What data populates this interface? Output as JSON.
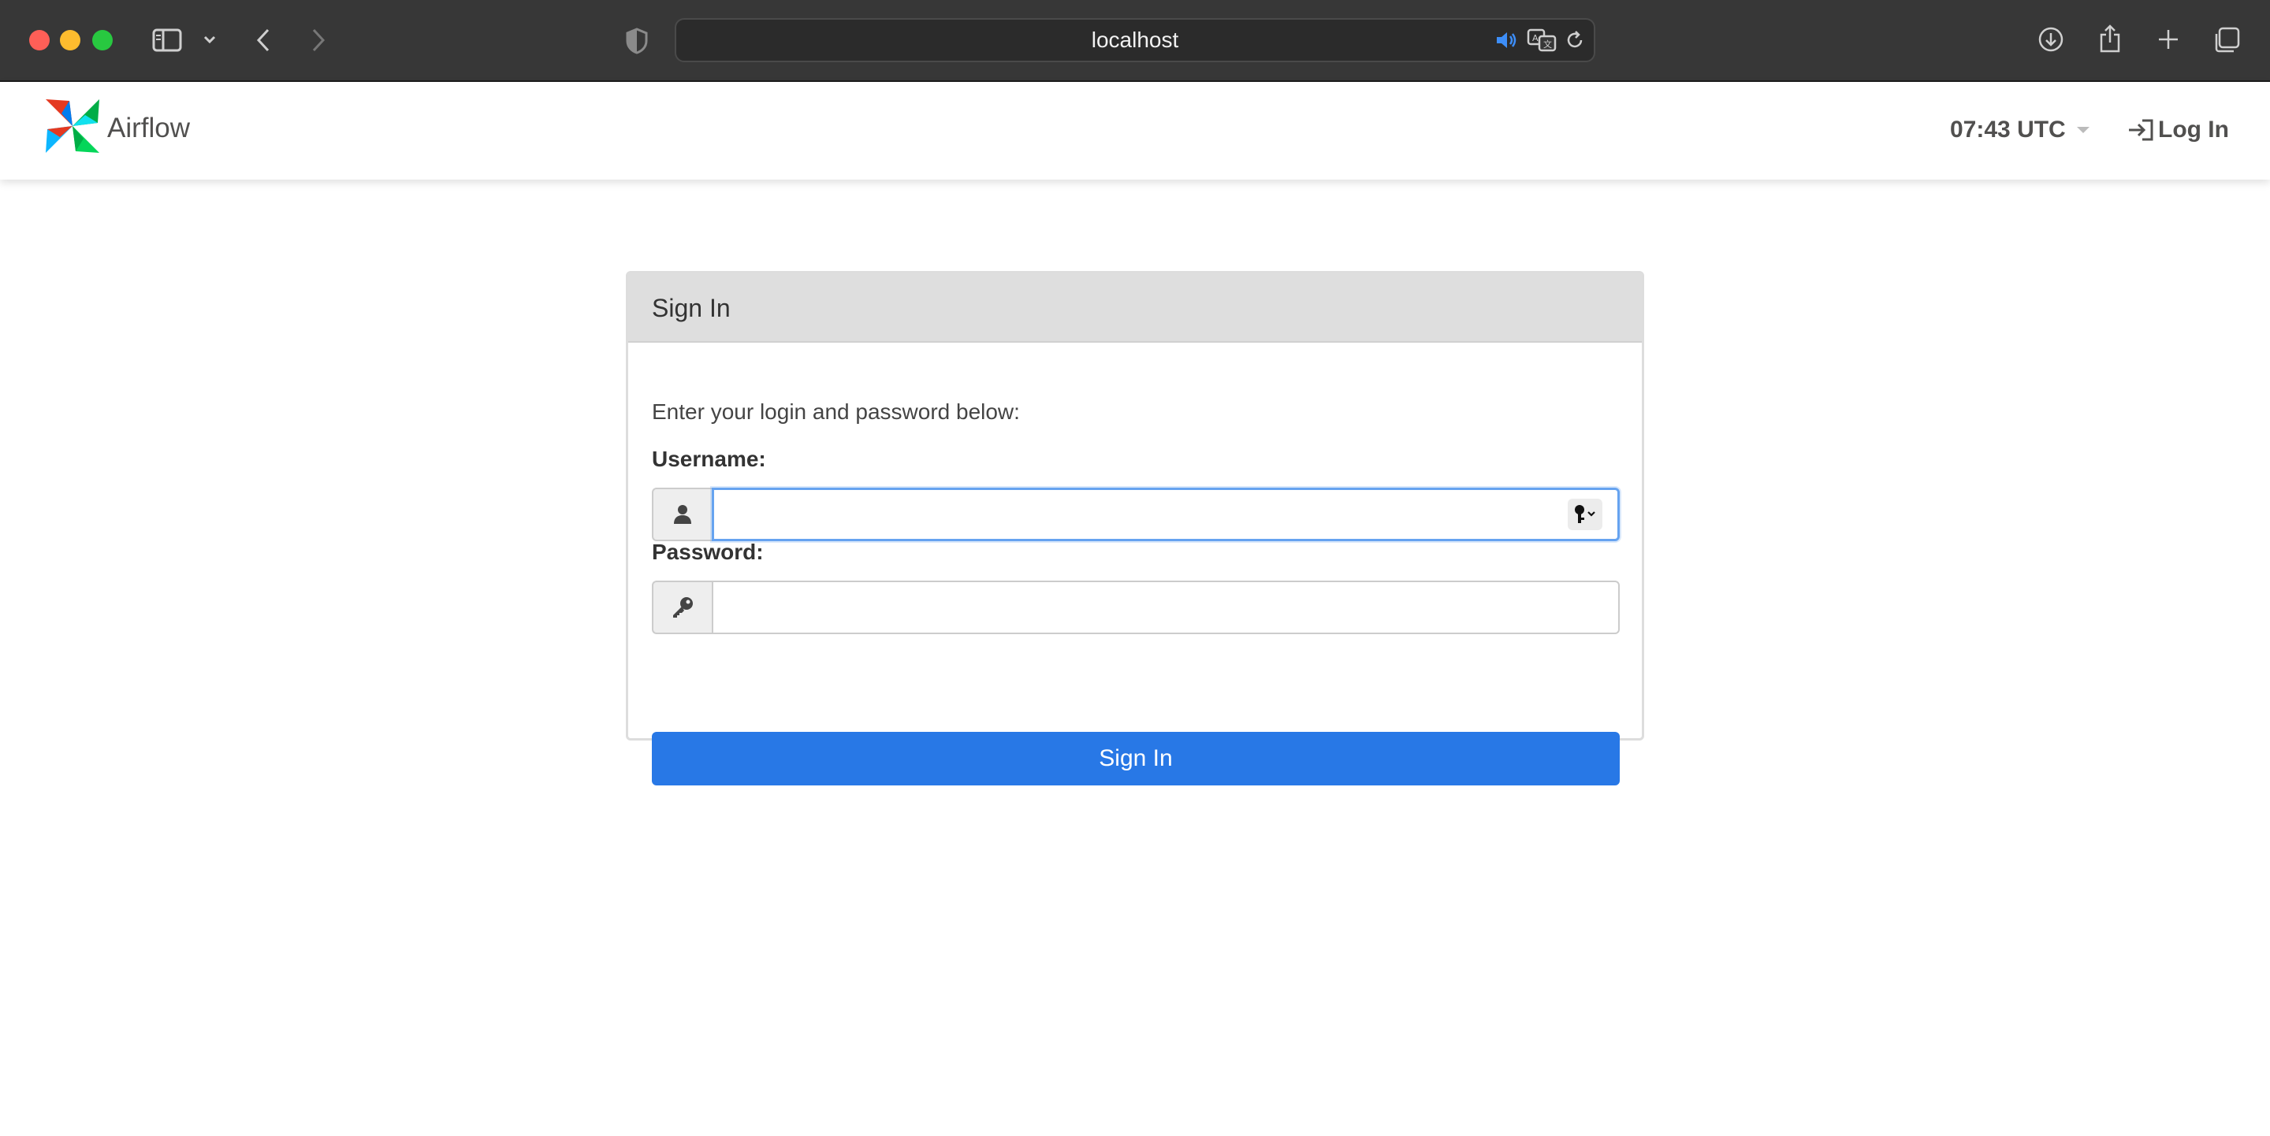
{
  "browser": {
    "url": "localhost",
    "icons": {
      "sidebar": "sidebar-icon",
      "back": "chevron-left-icon",
      "forward": "chevron-right-icon",
      "shield": "privacy-shield-icon",
      "audio": "speaker-icon",
      "translate": "translate-icon",
      "reload": "reload-icon",
      "downloads": "download-icon",
      "share": "share-icon",
      "new_tab": "plus-icon",
      "tabs": "tab-overview-icon"
    }
  },
  "navbar": {
    "brand": "Airflow",
    "clock": "07:43 UTC",
    "login": "Log In"
  },
  "signin": {
    "heading": "Sign In",
    "intro": "Enter your login and password below:",
    "username_label": "Username:",
    "username_value": "",
    "password_label": "Password:",
    "password_value": "",
    "submit_label": "Sign In"
  },
  "colors": {
    "chrome_bg": "#373737",
    "primary_button": "#2878e6",
    "panel_heading_bg": "#dedede",
    "focus_border": "#66a3f0"
  }
}
